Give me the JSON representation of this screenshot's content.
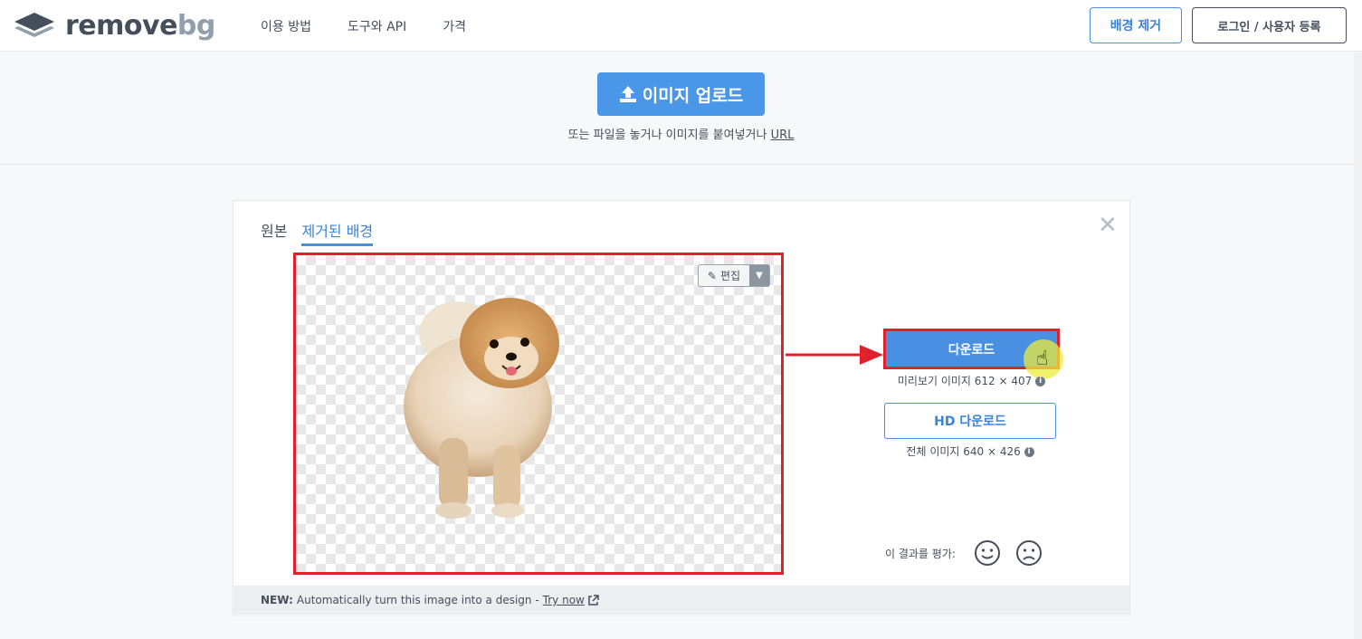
{
  "header": {
    "logo": {
      "part1": "remove",
      "part2": "bg"
    },
    "nav": [
      "이용 방법",
      "도구와 API",
      "가격"
    ],
    "remove_bg_button": "배경 제거",
    "login_button": "로그인 / 사용자 등록"
  },
  "upload": {
    "button_label": "이미지 업로드",
    "hint_text": "또는 파일을 놓거나 이미지를 붙여넣거나",
    "hint_link": "URL"
  },
  "card": {
    "tabs": [
      "원본",
      "제거된 배경"
    ],
    "active_tab": "제거된 배경",
    "edit_label": "편집",
    "download_label": "다운로드",
    "preview_info": "미리보기 이미지 612 × 407",
    "hd_download_label": "HD 다운로드",
    "full_info": "전체 이미지 640 × 426",
    "rate_label": "이 결과를 평가:",
    "footer": {
      "prefix": "NEW:",
      "text": "Automatically turn this image into a design -",
      "link": "Try now"
    }
  },
  "colors": {
    "accent": "#4a90e2",
    "highlight": "#e0202b",
    "text": "#454f5b"
  }
}
